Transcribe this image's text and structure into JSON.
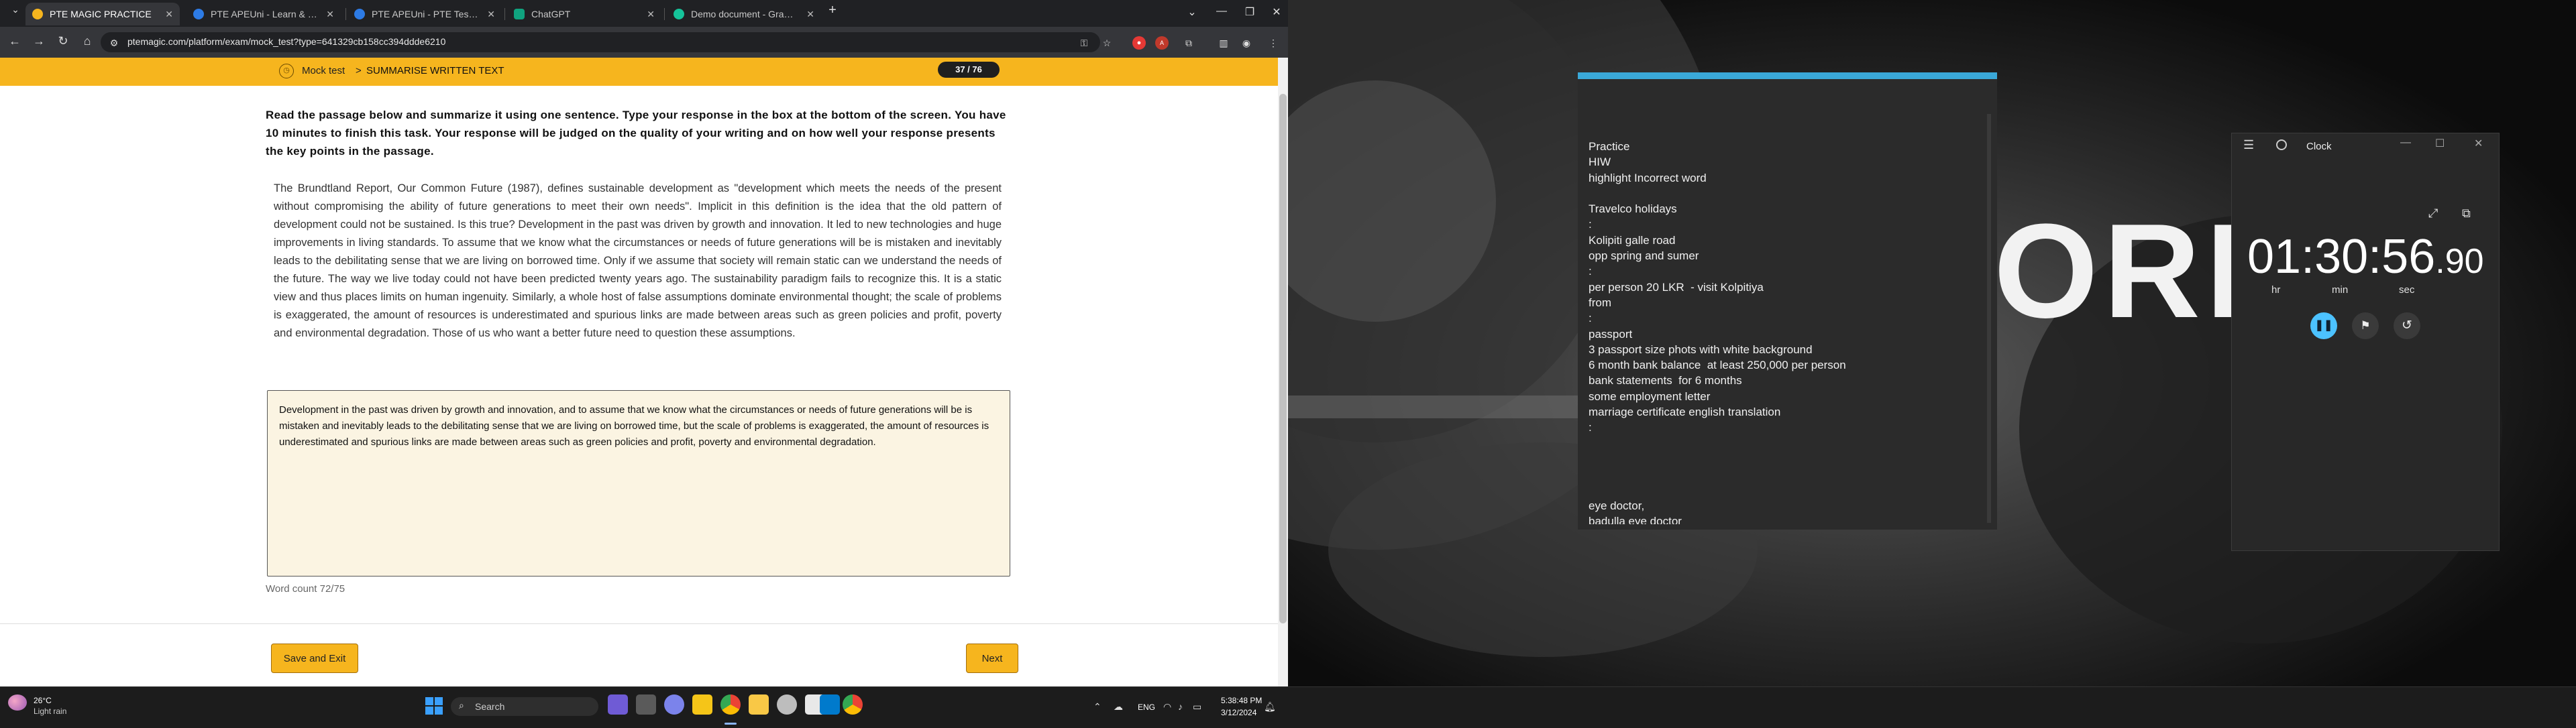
{
  "browser": {
    "tabs": [
      {
        "title": "PTE MAGIC PRACTICE",
        "active": true,
        "favicon_color": "#f6b51e"
      },
      {
        "title": "PTE APEUni - Learn & Practice",
        "active": false,
        "favicon_color": "#2d7be5"
      },
      {
        "title": "PTE APEUni - PTE Test Practice",
        "active": false,
        "favicon_color": "#2d7be5"
      },
      {
        "title": "ChatGPT",
        "active": false,
        "favicon_color": "#10a37f"
      },
      {
        "title": "Demo document - Grammarly",
        "active": false,
        "favicon_color": "#15c39a"
      }
    ],
    "new_tab": "+",
    "url": "ptemagic.com/platform/exam/mock_test?type=641329cb158cc394ddde6210"
  },
  "page": {
    "breadcrumb_root": "Mock test",
    "breadcrumb_separator": ">",
    "breadcrumb_current": "SUMMARISE WRITTEN TEXT",
    "progress": "37 / 76",
    "instructions": "Read the passage below and summarize it using one sentence. Type your response in the box at the bottom of the screen. You have 10 minutes to finish this task. Your response will be judged on the quality of your writing and on how well your response presents the key points in the passage.",
    "passage": "The Brundtland Report, Our Common Future (1987), defines sustainable development as \"development which meets the needs of the present without compromising the ability of future generations to meet their own needs\". Implicit in this definition is the idea that the old pattern of development could not be sustained. Is this true? Development in the past was driven by growth and innovation. It led to new technologies and huge improvements in living standards. To assume that we know what the circumstances or needs of future generations will be is mistaken and inevitably leads to the debilitating sense that we are living on borrowed time. Only if we assume that society will remain static can we understand the needs of the future. The way we live today could not have been predicted twenty years ago. The sustainability paradigm fails to recognize this. It is a static view and thus places limits on human ingenuity. Similarly, a whole host of false assumptions dominate environmental thought; the scale of problems is exaggerated, the amount of resources is underestimated and spurious links are made between areas such as green policies and profit, poverty and environmental degradation. Those of us who want a better future need to question these assumptions.",
    "answer": "Development in the past was driven by growth and innovation, and to assume that we know what the circumstances or needs of future generations will be is mistaken and inevitably leads to the debilitating sense that we are living on borrowed time, but the scale of problems is exaggerated, the amount of resources is underestimated and spurious links are made between areas such as green policies and profit, poverty and environmental degradation.",
    "word_count": "Word count 72/75",
    "save_exit_label": "Save and Exit",
    "next_label": "Next"
  },
  "notepad": {
    "text": "Practice\nHIW\nhighlight Incorrect word\n\nTravelco holidays\n:\nKolipiti galle road\nopp spring and sumer\n:\nper person 20 LKR  - visit Kolpitiya\nfrom\n:\npassport\n3 passport size phots with white background\n6 month bank balance  at least 250,000 per person\nbank statements  for 6 months\nsome employment letter\nmarriage certificate english translation\n:\n\n\n\n\neye doctor,\nbadulla eye doctor"
  },
  "clock": {
    "title": "Clock",
    "time_main": "01:30:56",
    "time_fraction": ".90",
    "label_hr": "hr",
    "label_min": "min",
    "label_sec": "sec",
    "accent_color": "#4cc2ff"
  },
  "wallpaper": {
    "text": "ORI"
  },
  "taskbar": {
    "weather_temp": "26°C",
    "weather_desc": "Light rain",
    "search_placeholder": "Search",
    "language": "ENG",
    "time": "5:38:48 PM",
    "date": "3/12/2024"
  }
}
